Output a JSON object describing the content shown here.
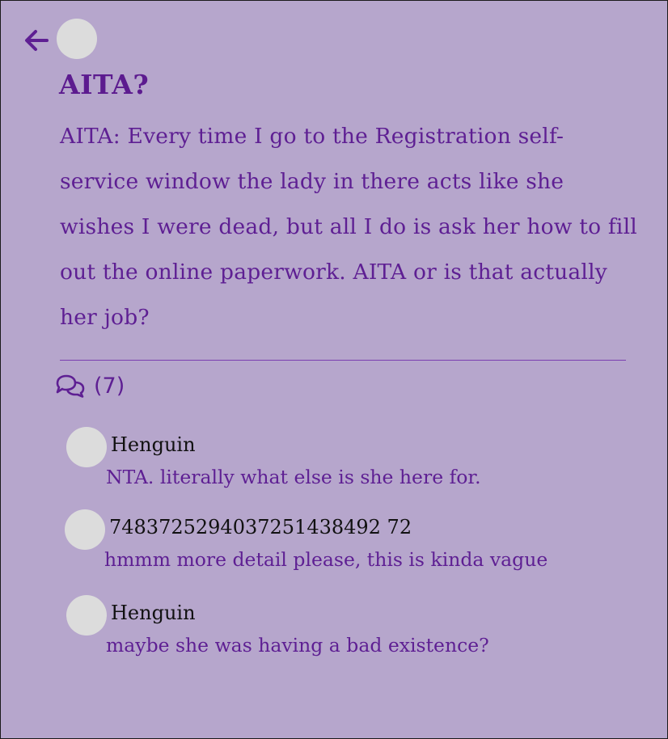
{
  "colors": {
    "background": "#b6a6cc",
    "accent": "#5e1f93",
    "avatar": "#dcdcdc",
    "author": "#111111"
  },
  "nav": {
    "back_icon": "arrow-left-icon"
  },
  "post": {
    "title": "AITA?",
    "body": "AITA: Every time I go to the Registration self-service window the lady in there acts like she wishes I were dead, but all I do is ask her how to fill out the online paperwork. AITA or is that actually her job?",
    "comments_icon": "speech-bubbles-icon",
    "comment_count_label": "(7)"
  },
  "comments": [
    {
      "author": "Henguin",
      "text": "NTA. literally what else is she here for."
    },
    {
      "author": "7483725294037251438492 72",
      "text": "hmmm more detail please, this is kinda vague"
    },
    {
      "author": "Henguin",
      "text": "maybe she was having a bad existence?"
    }
  ]
}
